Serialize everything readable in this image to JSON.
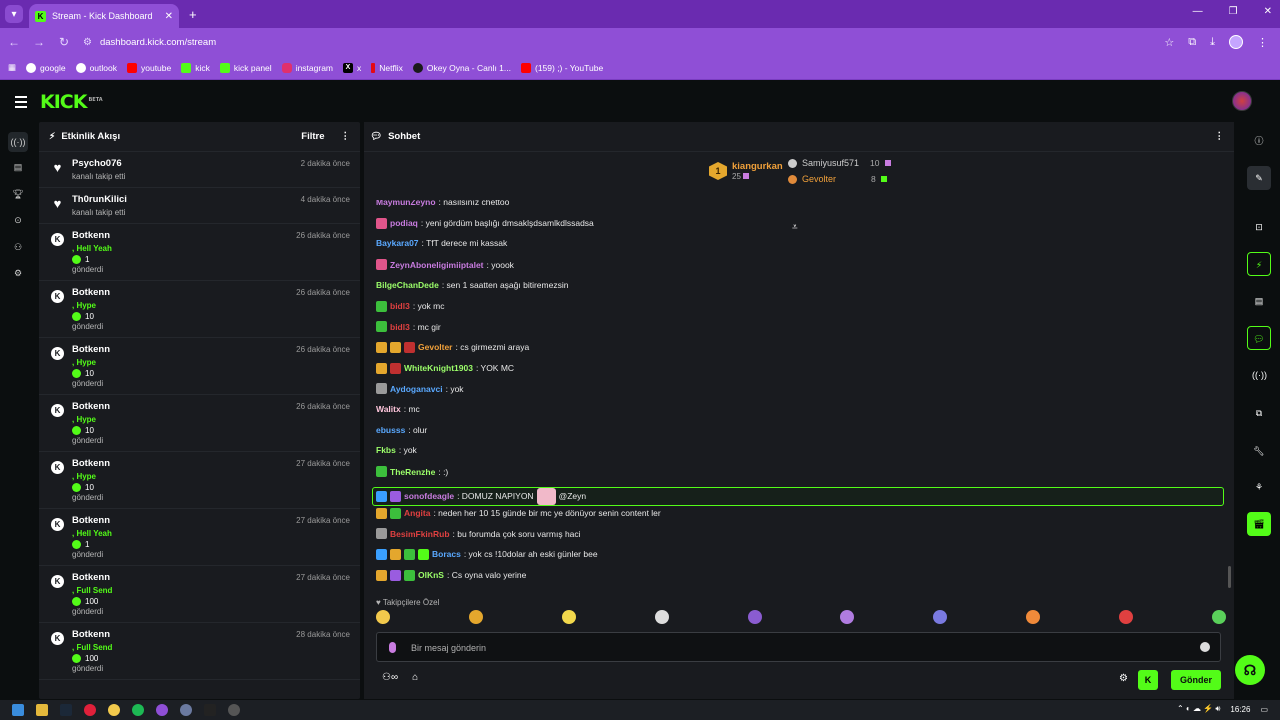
{
  "browser": {
    "tab_title": "Stream - Kick Dashboard",
    "url": "dashboard.kick.com/stream",
    "bookmarks": [
      {
        "label": "google",
        "color": "#ffffff"
      },
      {
        "label": "outlook",
        "color": "#ffffff"
      },
      {
        "label": "youtube",
        "color": "#ff0000"
      },
      {
        "label": "kick",
        "color": "#53fc18"
      },
      {
        "label": "kick panel",
        "color": "#53fc18"
      },
      {
        "label": "instagram",
        "color": "#e1306c"
      },
      {
        "label": "x",
        "color": "#000000"
      },
      {
        "label": "Netflix",
        "color": "#e50914"
      },
      {
        "label": "Okey Oyna - Canlı 1...",
        "color": "#1a1a1a"
      },
      {
        "label": "(159) ;) - YouTube",
        "color": "#ff0000"
      }
    ]
  },
  "kick": {
    "logo": "KICK",
    "logo_tag": "BETA"
  },
  "activity": {
    "title": "Etkinlik Akışı",
    "filter_label": "Filtre",
    "events": [
      {
        "name": "Psycho076",
        "time": "2 dakika önce",
        "action": "kanalı takip etti",
        "type": "follow"
      },
      {
        "name": "Th0runKilici",
        "time": "4 dakika önce",
        "action": "kanalı takip etti",
        "type": "follow"
      },
      {
        "name": "Botkenn",
        "time": "26 dakika önce",
        "tag": ", Hell Yeah",
        "count": "1",
        "action": "gönderdi",
        "type": "kicks"
      },
      {
        "name": "Botkenn",
        "time": "26 dakika önce",
        "tag": ", Hype",
        "count": "10",
        "action": "gönderdi",
        "type": "kicks"
      },
      {
        "name": "Botkenn",
        "time": "26 dakika önce",
        "tag": ", Hype",
        "count": "10",
        "action": "gönderdi",
        "type": "kicks"
      },
      {
        "name": "Botkenn",
        "time": "26 dakika önce",
        "tag": ", Hype",
        "count": "10",
        "action": "gönderdi",
        "type": "kicks"
      },
      {
        "name": "Botkenn",
        "time": "27 dakika önce",
        "tag": ", Hype",
        "count": "10",
        "action": "gönderdi",
        "type": "kicks"
      },
      {
        "name": "Botkenn",
        "time": "27 dakika önce",
        "tag": ", Hell Yeah",
        "count": "1",
        "action": "gönderdi",
        "type": "kicks"
      },
      {
        "name": "Botkenn",
        "time": "27 dakika önce",
        "tag": ", Full Send",
        "count": "100",
        "action": "gönderdi",
        "type": "kicks"
      },
      {
        "name": "Botkenn",
        "time": "28 dakika önce",
        "tag": ", Full Send",
        "count": "100",
        "action": "gönderdi",
        "type": "kicks"
      }
    ]
  },
  "chat": {
    "title": "Sohbet",
    "leaderboard": {
      "first": {
        "name": "kiangurkan",
        "rank": "1",
        "value": "25"
      },
      "second": {
        "name": "Samiyusuf571",
        "value": "10"
      },
      "third": {
        "name": "Gevolter",
        "value": "8"
      }
    },
    "messages": [
      {
        "user": "MaymunZeyno",
        "text": ": nasılsınız chettoo",
        "color": "#c97ce0",
        "badges": []
      },
      {
        "user": "podiaq",
        "text": ": yeni gördüm başlığı dmsaklşdsamlkdlssadsa",
        "color": "#c97ce0",
        "badges": [
          "#e0558a"
        ]
      },
      {
        "user": "Baykara07",
        "text": ": TfT derece mi kassak",
        "color": "#5aa9ff",
        "badges": []
      },
      {
        "user": "ZeynAboneligimiiptalet",
        "text": ": yoook",
        "color": "#c97ce0",
        "badges": [
          "#e0558a"
        ]
      },
      {
        "user": "BilgeChanDede",
        "text": ": sen 1 saatten aşağı bitiremezsin",
        "color": "#9cff6a",
        "badges": []
      },
      {
        "user": "bidl3",
        "text": ": yok mc",
        "color": "#e04040",
        "badges": [
          "#3cbf3c"
        ]
      },
      {
        "user": "bidl3",
        "text": ": mc gir",
        "color": "#e04040",
        "badges": [
          "#3cbf3c"
        ]
      },
      {
        "user": "Gevolter",
        "text": ": cs girmezmi araya",
        "color": "#f0a03a",
        "badges": [
          "#e4a72d",
          "#e4a72d",
          "#c03030"
        ]
      },
      {
        "user": "WhiteKnight1903",
        "text": ": YOK MC",
        "color": "#9cff6a",
        "badges": [
          "#e4a72d",
          "#c03030"
        ]
      },
      {
        "user": "Aydoganavci",
        "text": ": yok",
        "color": "#5aa9ff",
        "badges": [
          "#9a9a9a"
        ]
      },
      {
        "user": "Walitx",
        "text": ": mc",
        "color": "#ffc6dc",
        "badges": []
      },
      {
        "user": "ebusss",
        "text": ": olur",
        "color": "#5aa9ff",
        "badges": []
      },
      {
        "user": "Fkbs",
        "text": ": yok",
        "color": "#9cff6a",
        "badges": []
      },
      {
        "user": "TheRenzhe",
        "text": ": :)",
        "color": "#9cff6a",
        "badges": [
          "#3cbf3c"
        ]
      },
      {
        "user": "sonofdeagle",
        "text": ": DOMUZ NAPIYON",
        "mention": "@Zeyn",
        "color": "#c97ce0",
        "badges": [
          "#3aa0ff",
          "#9a5ce0"
        ],
        "highlight": true
      },
      {
        "user": "Angita",
        "text": ": neden her 10 15 günde bir mc ye dönüyor senin content ler",
        "color": "#e04040",
        "badges": [
          "#e4a72d",
          "#3cbf3c"
        ]
      },
      {
        "user": "BesimFkinRub",
        "text": ": bu forumda çok soru varmış haci",
        "color": "#e04040",
        "badges": [
          "#9a9a9a"
        ]
      },
      {
        "user": "Boracs",
        "text": ": yok cs !10dolar ah eski günler bee",
        "color": "#5aa9ff",
        "badges": [
          "#3aa0ff",
          "#e4a72d",
          "#3cbf3c",
          "#53fc18"
        ]
      },
      {
        "user": "OlKnS",
        "text": ": Cs oyna valo yerine",
        "color": "#9cff6a",
        "badges": [
          "#e4a72d",
          "#9a5ce0",
          "#3cbf3c"
        ]
      }
    ],
    "favorites_label": "Takipçilere Özel",
    "emote_colors": [
      "#f2c94c",
      "#e4a72d",
      "#f2d84c",
      "#dddddd",
      "#8a5cd0",
      "#b07ce0",
      "#7a7ae0",
      "#f08a3a",
      "#e04040",
      "#5ad05a"
    ],
    "input_placeholder": "Bir mesaj gönderin",
    "send_label": "Gönder"
  },
  "taskbar": {
    "time": "16:26"
  }
}
